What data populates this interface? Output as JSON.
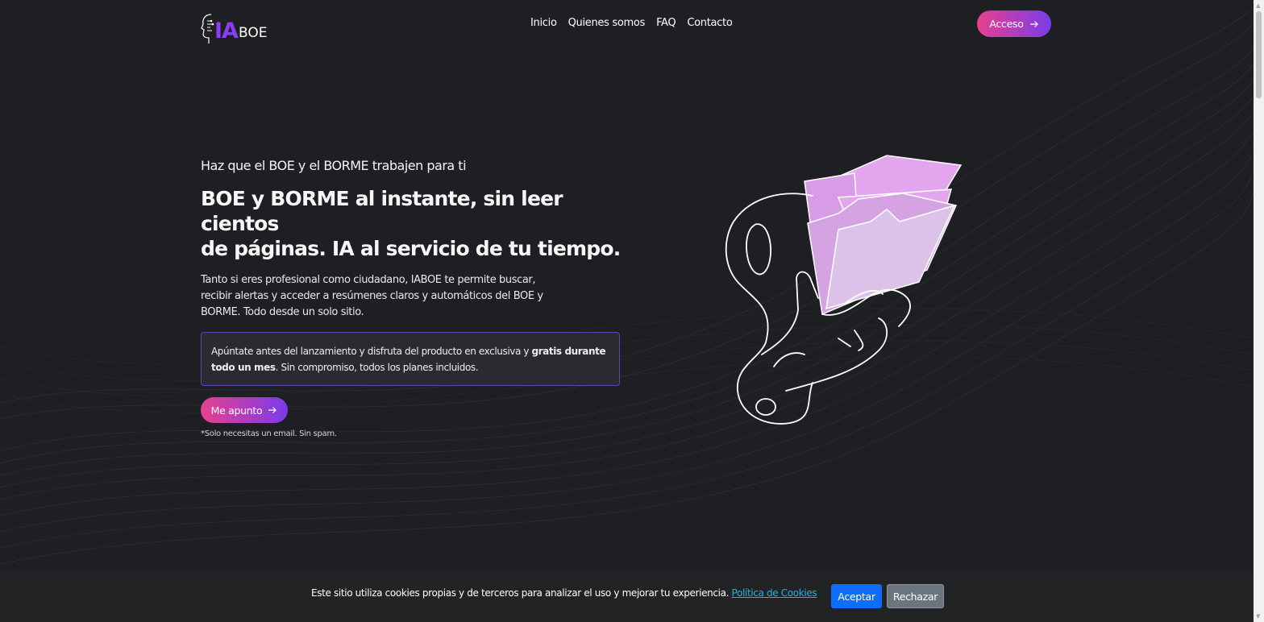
{
  "logo": {
    "ia": "IA",
    "boe": "BOE"
  },
  "nav": {
    "items": [
      "Inicio",
      "Quienes somos",
      "FAQ",
      "Contacto"
    ]
  },
  "header": {
    "access_label": "Acceso",
    "arrow_icon": "arrow-right-icon"
  },
  "hero": {
    "eyebrow": "Haz que el BOE y el BORME trabajen para ti",
    "title_line1": "BOE y BORME al instante, sin leer cientos",
    "title_line2": "de páginas. IA al servicio de tu tiempo.",
    "desc_line1": "Tanto si eres profesional como ciudadano, IABOE te permite buscar,",
    "desc_line2": "recibir alertas y acceder a resúmenes claros y automáticos del BOE y",
    "desc_line3": "BORME. Todo desde un solo sitio.",
    "promo_before": "Apúntate antes del lanzamiento y disfruta del producto en exclusiva y ",
    "promo_bold": "gratis durante todo un mes",
    "promo_after": ". Sin compromiso, todos los planes incluidos.",
    "cta_label": "Me apunto",
    "note": "*Solo necesitas un email. Sin spam."
  },
  "cookie": {
    "text": "Este sitio utiliza cookies propias y de terceros para analizar el uso y mejorar tu experiencia.",
    "link": "Política de Cookies",
    "accept": "Aceptar",
    "reject": "Rechazar"
  },
  "colors": {
    "background": "#1e1f23",
    "accent_pink": "#e8408f",
    "accent_purple": "#7a3bea",
    "logo_purple": "#8b3df0",
    "folder_pink": "#e3a6ee",
    "accept_blue": "#0d6efd",
    "reject_gray": "#6c757d",
    "link_cyan": "#18b7e6"
  }
}
